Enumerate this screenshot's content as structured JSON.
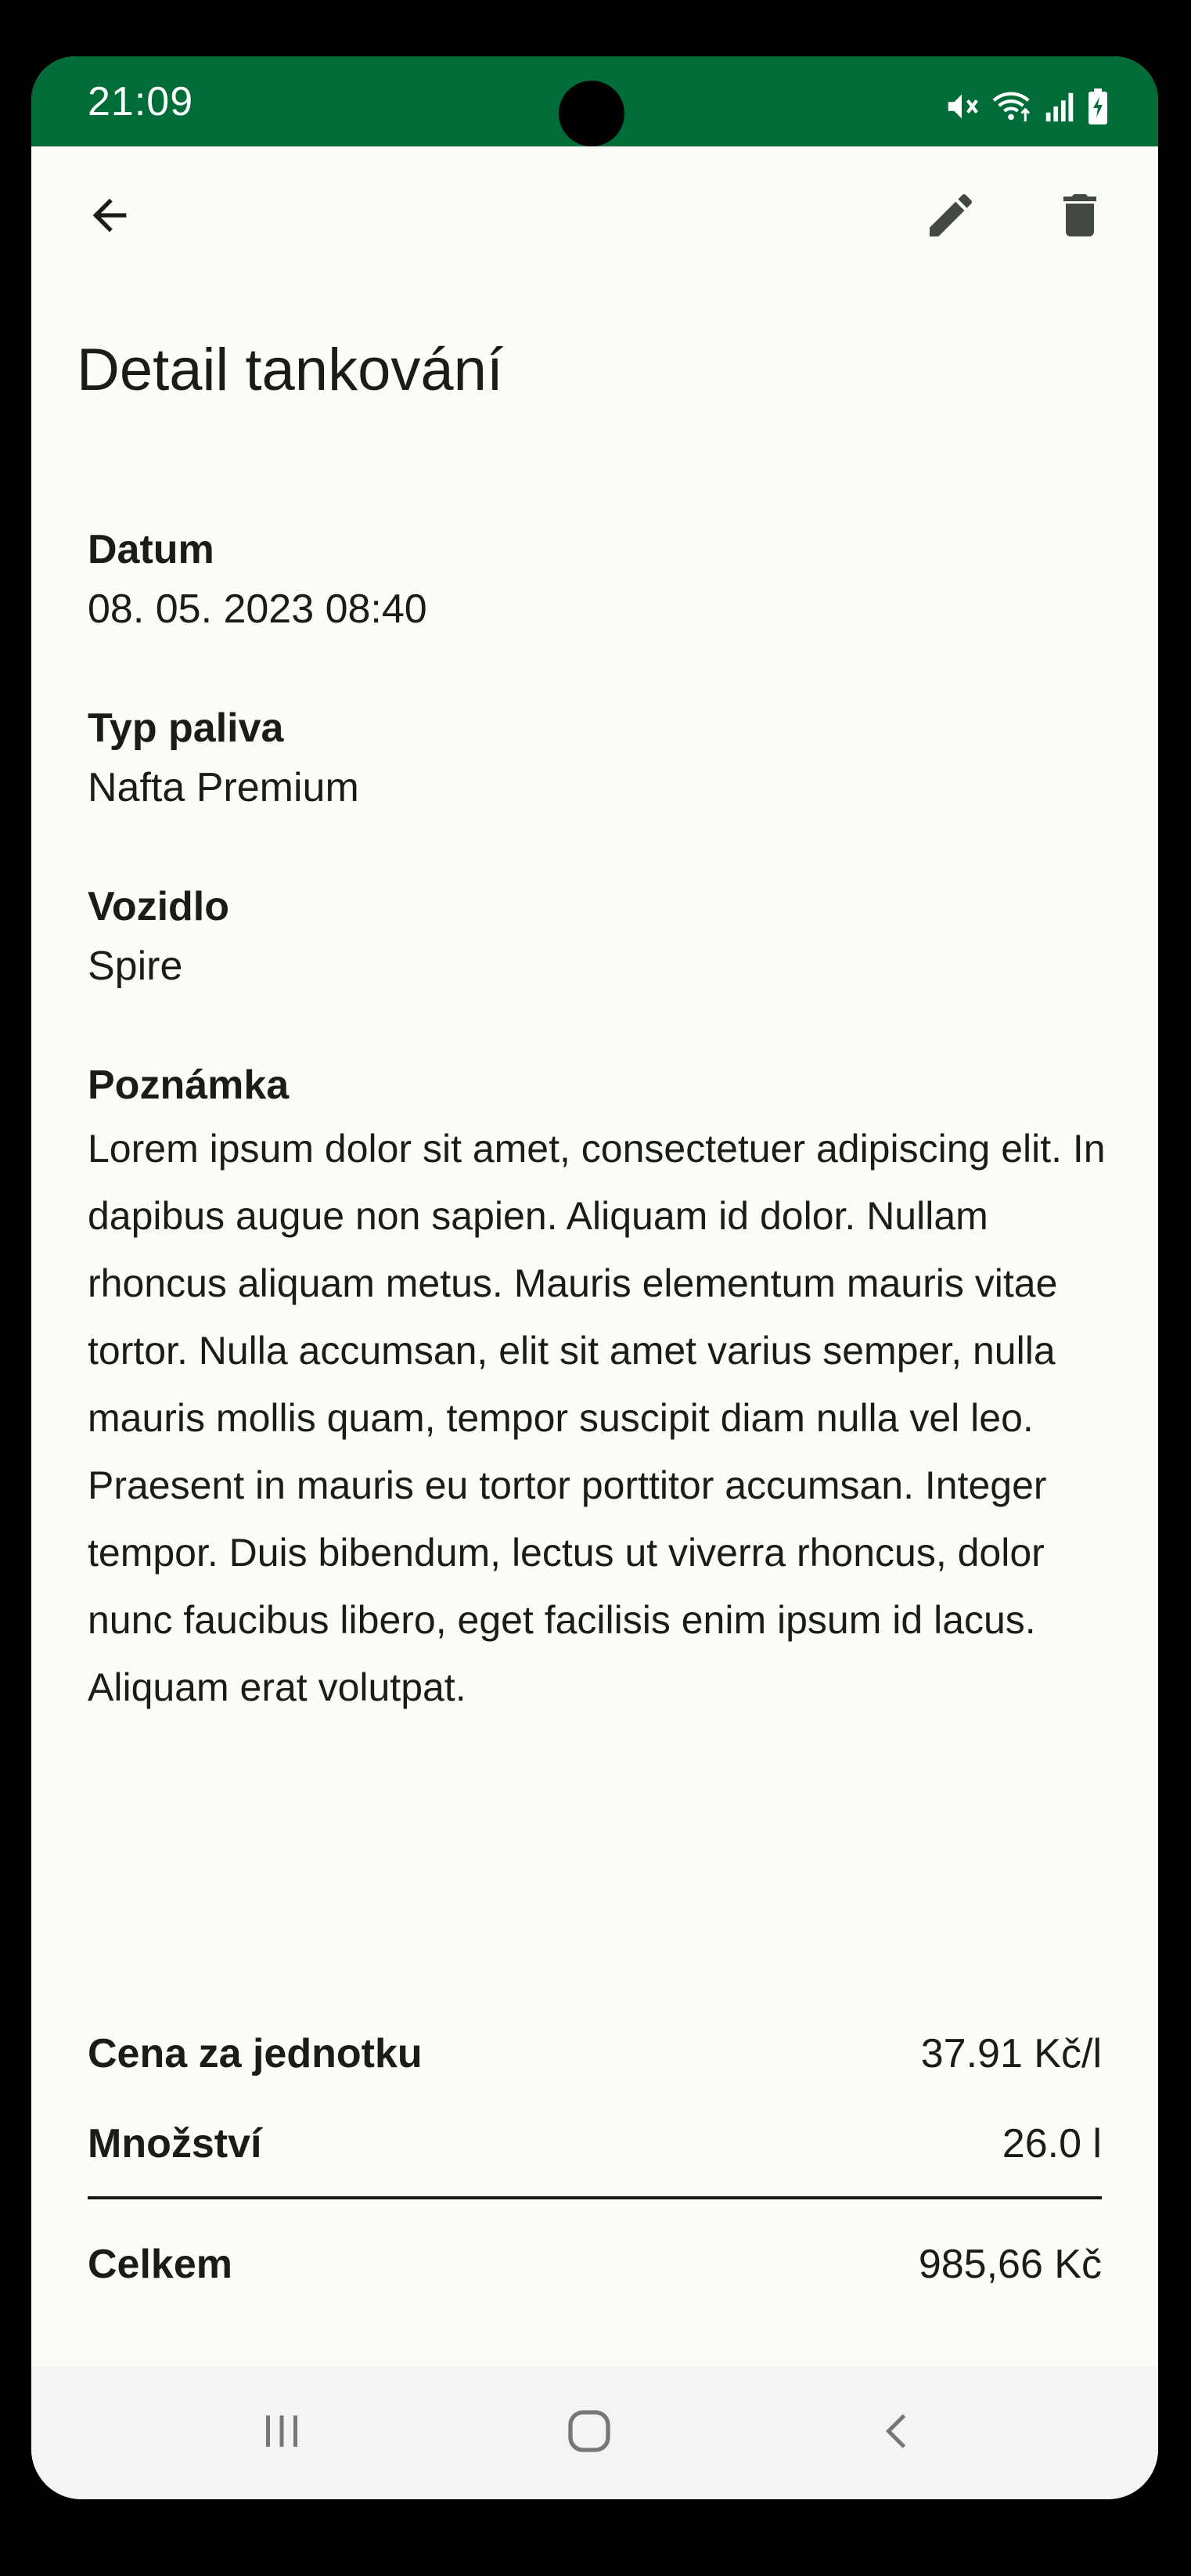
{
  "status_bar": {
    "time": "21:09",
    "background_color": "#006d38",
    "icons": [
      "mute-icon",
      "wifi-icon",
      "signal-icon",
      "battery-charging-icon"
    ]
  },
  "app_bar": {
    "back_icon": "arrow-back-icon",
    "edit_icon": "pencil-icon",
    "delete_icon": "trash-icon"
  },
  "page": {
    "title": "Detail tankování"
  },
  "details": {
    "date": {
      "label": "Datum",
      "value": "08. 05. 2023 08:40"
    },
    "fuel_type": {
      "label": "Typ paliva",
      "value": "Nafta Premium"
    },
    "vehicle": {
      "label": "Vozidlo",
      "value": "Spire"
    },
    "note": {
      "label": "Poznámka",
      "value": "Lorem ipsum dolor sit amet, consectetuer adipiscing elit. In dapibus augue non sapien. Aliquam id dolor. Nullam rhoncus aliquam metus. Mauris elementum mauris vitae tortor. Nulla accumsan, elit sit amet varius semper, nulla mauris mollis quam, tempor suscipit diam nulla vel leo. Praesent in mauris eu tortor porttitor accumsan. Integer tempor. Duis bibendum, lectus ut viverra rhoncus, dolor nunc faucibus libero, eget facilisis enim ipsum id lacus. Aliquam erat volutpat."
    }
  },
  "summary": {
    "unit_price": {
      "label": "Cena za jednotku",
      "value": "37.91 Kč/l"
    },
    "quantity": {
      "label": "Množství",
      "value": "26.0 l"
    },
    "total": {
      "label": "Celkem",
      "value": "985,66 Kč"
    }
  },
  "nav_bar": {
    "icons": [
      "recent-apps-icon",
      "home-icon",
      "back-icon"
    ]
  }
}
